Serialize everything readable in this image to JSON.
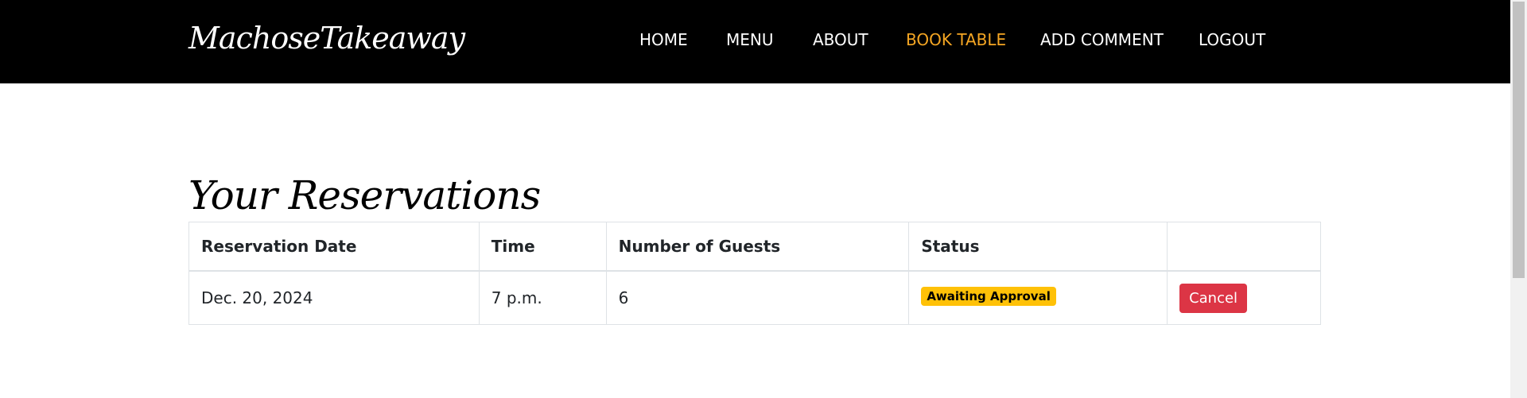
{
  "brand": {
    "name": "MachoseTakeaway"
  },
  "nav": {
    "items": [
      {
        "label": "HOME",
        "active": false
      },
      {
        "label": "MENU",
        "active": false
      },
      {
        "label": "ABOUT",
        "active": false
      },
      {
        "label": "BOOK TABLE",
        "active": true
      },
      {
        "label": "ADD COMMENT",
        "active": false
      },
      {
        "label": "LOGOUT",
        "active": false
      }
    ]
  },
  "colors": {
    "navbar_bg": "#000000",
    "active_link": "#f5a623",
    "badge_warning": "#ffc107",
    "button_danger": "#dc3545"
  },
  "main": {
    "title": "Your Reservations",
    "table": {
      "headers": [
        "Reservation Date",
        "Time",
        "Number of Guests",
        "Status",
        ""
      ],
      "rows": [
        {
          "date": "Dec. 20, 2024",
          "time": "7 p.m.",
          "guests": "6",
          "status": "Awaiting Approval",
          "action": "Cancel"
        }
      ]
    }
  }
}
